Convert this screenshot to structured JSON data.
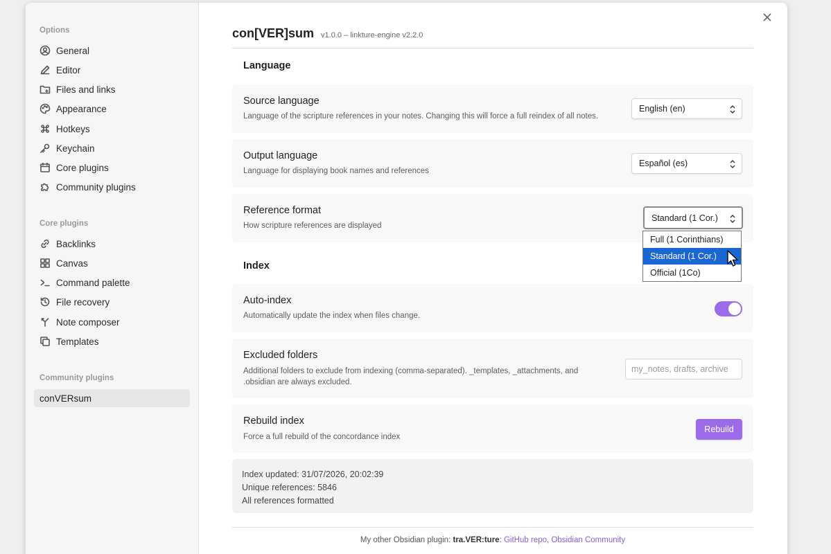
{
  "sidebar": {
    "options_heading": "Options",
    "options_items": [
      {
        "label": "General",
        "icon": "user-circle-icon"
      },
      {
        "label": "Editor",
        "icon": "pencil-icon"
      },
      {
        "label": "Files and links",
        "icon": "folder-link-icon"
      },
      {
        "label": "Appearance",
        "icon": "palette-icon"
      },
      {
        "label": "Hotkeys",
        "icon": "command-icon"
      },
      {
        "label": "Keychain",
        "icon": "key-icon"
      },
      {
        "label": "Core plugins",
        "icon": "calendar-box-icon"
      },
      {
        "label": "Community plugins",
        "icon": "puzzle-icon"
      }
    ],
    "core_heading": "Core plugins",
    "core_items": [
      {
        "label": "Backlinks",
        "icon": "link-icon"
      },
      {
        "label": "Canvas",
        "icon": "grid-icon"
      },
      {
        "label": "Command palette",
        "icon": "terminal-icon"
      },
      {
        "label": "File recovery",
        "icon": "history-icon"
      },
      {
        "label": "Note composer",
        "icon": "merge-icon"
      },
      {
        "label": "Templates",
        "icon": "copy-icon"
      }
    ],
    "community_heading": "Community plugins",
    "community_items": [
      {
        "label": "conVERsum",
        "active": true
      }
    ]
  },
  "header": {
    "title": "con[VER]sum",
    "version": "v1.0.0 – linkture-engine v2.2.0"
  },
  "language_section": {
    "heading": "Language",
    "source": {
      "name": "Source language",
      "desc": "Language of the scripture references in your notes. Changing this will force a full reindex of all notes.",
      "value": "English (en)"
    },
    "output": {
      "name": "Output language",
      "desc": "Language for displaying book names and references",
      "value": "Español (es)"
    },
    "format": {
      "name": "Reference format",
      "desc": "How scripture references are displayed",
      "value": "Standard (1 Cor.)",
      "options": [
        "Full (1 Corinthians)",
        "Standard (1 Cor.)",
        "Official (1Co)"
      ],
      "selected_index": 1
    }
  },
  "index_section": {
    "heading": "Index",
    "auto_index": {
      "name": "Auto-index",
      "desc": "Automatically update the index when files change.",
      "enabled": true
    },
    "excluded": {
      "name": "Excluded folders",
      "desc": "Additional folders to exclude from indexing (comma-separated). _templates, _attachments, and .obsidian are always excluded.",
      "value": "",
      "placeholder": "my_notes, drafts, archive"
    },
    "rebuild": {
      "name": "Rebuild index",
      "desc": "Force a full rebuild of the concordance index",
      "button_label": "Rebuild"
    }
  },
  "status": {
    "updated": "Index updated: 31/07/2026, 20:02:39",
    "unique": "Unique references: 5846",
    "formatted": "All references formatted"
  },
  "footer": {
    "prefix": "My other Obsidian plugin: ",
    "plugin_name": "tra.VER:ture",
    "separator": ": ",
    "link1": "GitHub repo",
    "comma": ", ",
    "link2": "Obsidian Community"
  },
  "colors": {
    "accent": "#9b6bea",
    "selection": "#1a66d2"
  }
}
